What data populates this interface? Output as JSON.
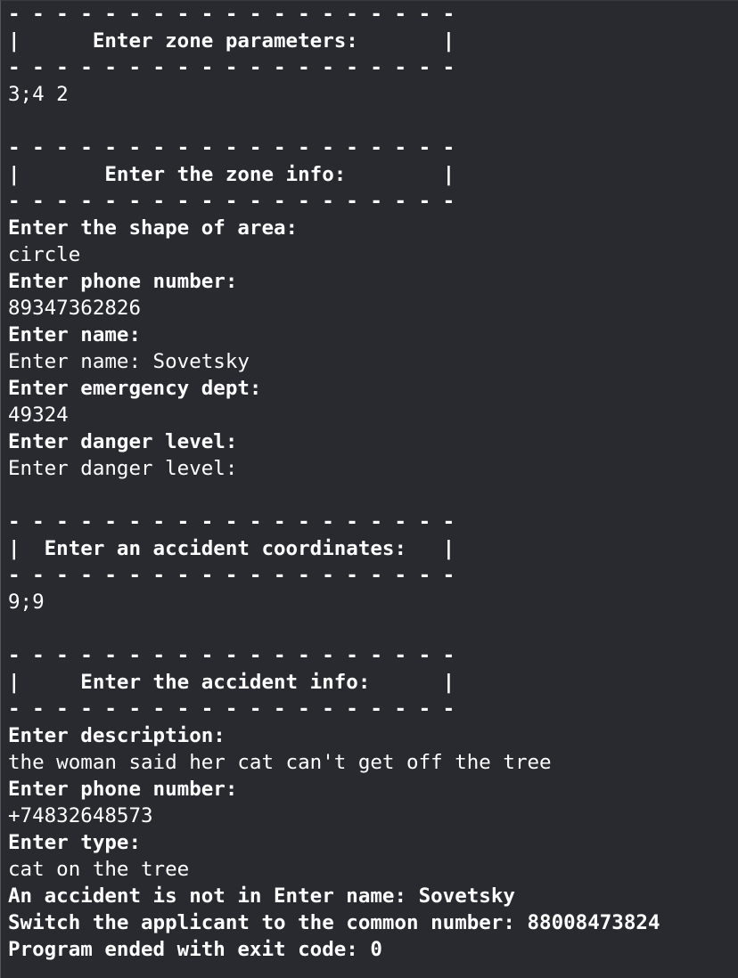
{
  "console": {
    "lines": [
      {
        "text": "- - - - - - - - - - - - - - - - - - -",
        "bold": true
      },
      {
        "text": "|      Enter zone parameters:       |",
        "bold": true
      },
      {
        "text": "- - - - - - - - - - - - - - - - - - -",
        "bold": true
      },
      {
        "text": "3;4 2",
        "bold": false
      },
      {
        "text": "",
        "bold": false
      },
      {
        "text": "- - - - - - - - - - - - - - - - - - -",
        "bold": true
      },
      {
        "text": "|       Enter the zone info:        |",
        "bold": true
      },
      {
        "text": "- - - - - - - - - - - - - - - - - - -",
        "bold": true
      },
      {
        "text": "Enter the shape of area:",
        "bold": true
      },
      {
        "text": "circle",
        "bold": false
      },
      {
        "text": "Enter phone number:",
        "bold": true
      },
      {
        "text": "89347362826",
        "bold": false
      },
      {
        "text": "Enter name:",
        "bold": true
      },
      {
        "text": "Enter name: Sovetsky",
        "bold": false
      },
      {
        "text": "Enter emergency dept:",
        "bold": true
      },
      {
        "text": "49324",
        "bold": false
      },
      {
        "text": "Enter danger level:",
        "bold": true
      },
      {
        "text": "Enter danger level:",
        "bold": false
      },
      {
        "text": "",
        "bold": false
      },
      {
        "text": "- - - - - - - - - - - - - - - - - - -",
        "bold": true
      },
      {
        "text": "|  Enter an accident coordinates:   |",
        "bold": true
      },
      {
        "text": "- - - - - - - - - - - - - - - - - - -",
        "bold": true
      },
      {
        "text": "9;9",
        "bold": false
      },
      {
        "text": "",
        "bold": false
      },
      {
        "text": "- - - - - - - - - - - - - - - - - - -",
        "bold": true
      },
      {
        "text": "|     Enter the accident info:      |",
        "bold": true
      },
      {
        "text": "- - - - - - - - - - - - - - - - - - -",
        "bold": true
      },
      {
        "text": "Enter description:",
        "bold": true
      },
      {
        "text": "the woman said her cat can't get off the tree",
        "bold": false
      },
      {
        "text": "Enter phone number:",
        "bold": true
      },
      {
        "text": "+74832648573",
        "bold": false
      },
      {
        "text": "Enter type:",
        "bold": true
      },
      {
        "text": "cat on the tree",
        "bold": false
      },
      {
        "text": "An accident is not in Enter name: Sovetsky",
        "bold": true
      },
      {
        "text": "Switch the applicant to the common number: 88008473824",
        "bold": true
      },
      {
        "text": "Program ended with exit code: 0",
        "bold": true
      }
    ]
  }
}
